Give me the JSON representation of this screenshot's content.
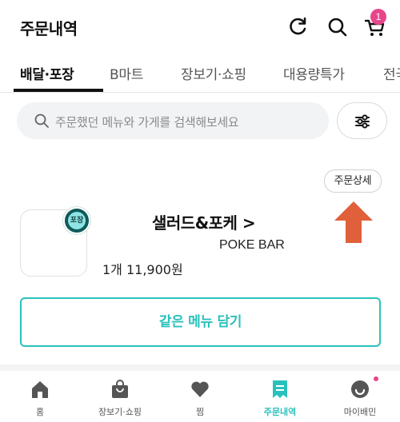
{
  "header": {
    "title": "주문내역",
    "cart_badge": "1",
    "icons": [
      "refresh-icon",
      "search-icon",
      "cart-icon"
    ]
  },
  "tabs": [
    {
      "label": "배달·포장",
      "active": true
    },
    {
      "label": "B마트",
      "active": false
    },
    {
      "label": "장보기·쇼핑",
      "active": false
    },
    {
      "label": "대용량특가",
      "active": false
    },
    {
      "label": "전국",
      "active": false
    }
  ],
  "search": {
    "placeholder": "주문했던 메뉴와 가게를 검색해보세요"
  },
  "order": {
    "detail_button": "주문상세",
    "tag": "포장",
    "store_name": "샐러드&포케 >",
    "store_subtitle": "POKE BAR",
    "summary": "1개 11,900원",
    "reorder_button": "같은 메뉴 담기"
  },
  "bottom_nav": [
    {
      "label": "홈",
      "icon": "home-icon"
    },
    {
      "label": "장보기·쇼핑",
      "icon": "shopping-bag-icon"
    },
    {
      "label": "찜",
      "icon": "heart-icon"
    },
    {
      "label": "주문내역",
      "icon": "order-list-icon",
      "active": true
    },
    {
      "label": "마이배민",
      "icon": "profile-icon"
    }
  ],
  "colors": {
    "accent": "#2ac1bc",
    "badge": "#e8468a",
    "annotation_arrow": "#e0603c"
  }
}
